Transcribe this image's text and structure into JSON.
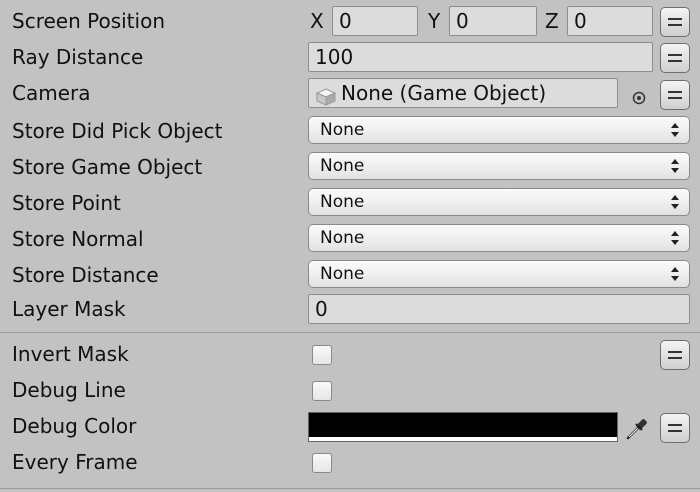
{
  "fields": {
    "screen_position": {
      "label": "Screen Position",
      "x_label": "X",
      "x_value": "0",
      "y_label": "Y",
      "y_value": "0",
      "z_label": "Z",
      "z_value": "0"
    },
    "ray_distance": {
      "label": "Ray Distance",
      "value": "100"
    },
    "camera": {
      "label": "Camera",
      "value": "None (Game Object)"
    },
    "store_did_pick_object": {
      "label": "Store Did Pick Object",
      "value": "None"
    },
    "store_game_object": {
      "label": "Store Game Object",
      "value": "None"
    },
    "store_point": {
      "label": "Store Point",
      "value": "None"
    },
    "store_normal": {
      "label": "Store Normal",
      "value": "None"
    },
    "store_distance": {
      "label": "Store Distance",
      "value": "None"
    },
    "layer_mask": {
      "label": "Layer Mask",
      "value": "0"
    },
    "invert_mask": {
      "label": "Invert Mask",
      "checked": false
    },
    "debug_line": {
      "label": "Debug Line",
      "checked": false
    },
    "debug_color": {
      "label": "Debug Color",
      "color": "#000000"
    },
    "every_frame": {
      "label": "Every Frame",
      "checked": false
    }
  },
  "icons": {
    "menu": "menu-icon",
    "object_picker": "object-picker-icon",
    "game_object": "cube-icon",
    "eyedropper": "eyedropper-icon"
  },
  "colors": {
    "panel_background": "#c2c2c2",
    "field_background": "#dcdcdc"
  }
}
